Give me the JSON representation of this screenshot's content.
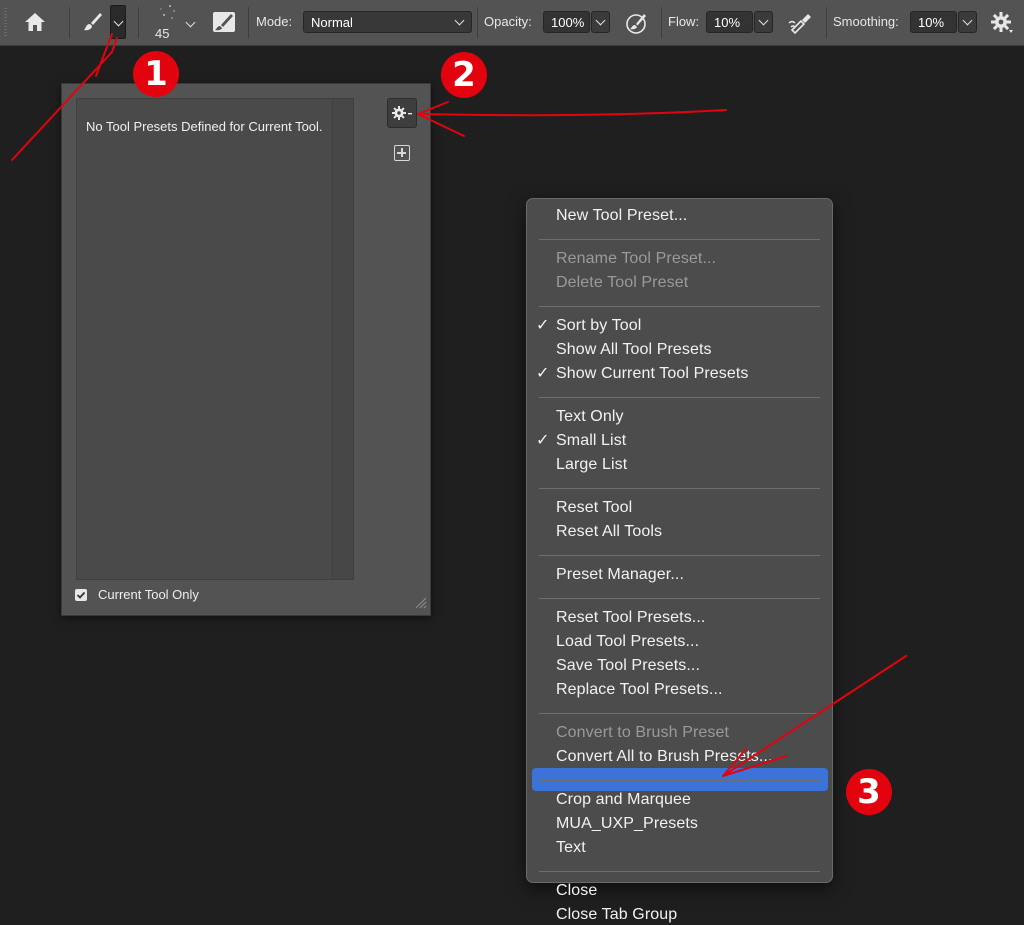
{
  "toolbar": {
    "brush_size": "45",
    "mode_label": "Mode:",
    "mode_value": "Normal",
    "opacity_label": "Opacity:",
    "opacity_value": "100%",
    "flow_label": "Flow:",
    "flow_value": "10%",
    "smoothing_label": "Smoothing:",
    "smoothing_value": "10%",
    "icons": [
      "home-icon",
      "brush-icon",
      "chevron-down-icon",
      "brush-settings-icon",
      "pressure-opacity-icon",
      "airbrush-icon",
      "gear-icon"
    ]
  },
  "panel": {
    "empty_message": "No Tool Presets Defined for Current Tool.",
    "current_tool_only_label": "Current Tool Only",
    "current_tool_only_checked": true,
    "gear_icon": "gear-icon",
    "new_preset_icon": "new-preset-icon"
  },
  "menu": {
    "highlight_color": "#3b73d9",
    "groups": [
      [
        {
          "label": "New Tool Preset..."
        }
      ],
      [
        {
          "label": "Rename Tool Preset...",
          "disabled": true
        },
        {
          "label": "Delete Tool Preset",
          "disabled": true
        }
      ],
      [
        {
          "label": "Sort by Tool",
          "checked": true
        },
        {
          "label": "Show All Tool Presets"
        },
        {
          "label": "Show Current Tool Presets",
          "checked": true
        }
      ],
      [
        {
          "label": "Text Only"
        },
        {
          "label": "Small List",
          "checked": true
        },
        {
          "label": "Large List"
        }
      ],
      [
        {
          "label": "Reset Tool"
        },
        {
          "label": "Reset All Tools"
        }
      ],
      [
        {
          "label": "Preset Manager..."
        }
      ],
      [
        {
          "label": "Reset Tool Presets..."
        },
        {
          "label": "Load Tool Presets..."
        },
        {
          "label": "Save Tool Presets..."
        },
        {
          "label": "Replace Tool Presets..."
        }
      ],
      [
        {
          "label": "Convert to Brush Preset",
          "disabled": true
        },
        {
          "label": "Convert All to Brush Presets..."
        }
      ],
      [
        {
          "label": "Crop and Marquee"
        },
        {
          "label": "MUA_UXP_Presets",
          "highlighted": true
        },
        {
          "label": "Text"
        }
      ],
      [
        {
          "label": "Close"
        },
        {
          "label": "Close Tab Group"
        }
      ]
    ],
    "check_glyph": "✓"
  },
  "annotations": {
    "badge_1": "1",
    "badge_2": "2",
    "badge_3": "3",
    "color": "#e3030e"
  }
}
